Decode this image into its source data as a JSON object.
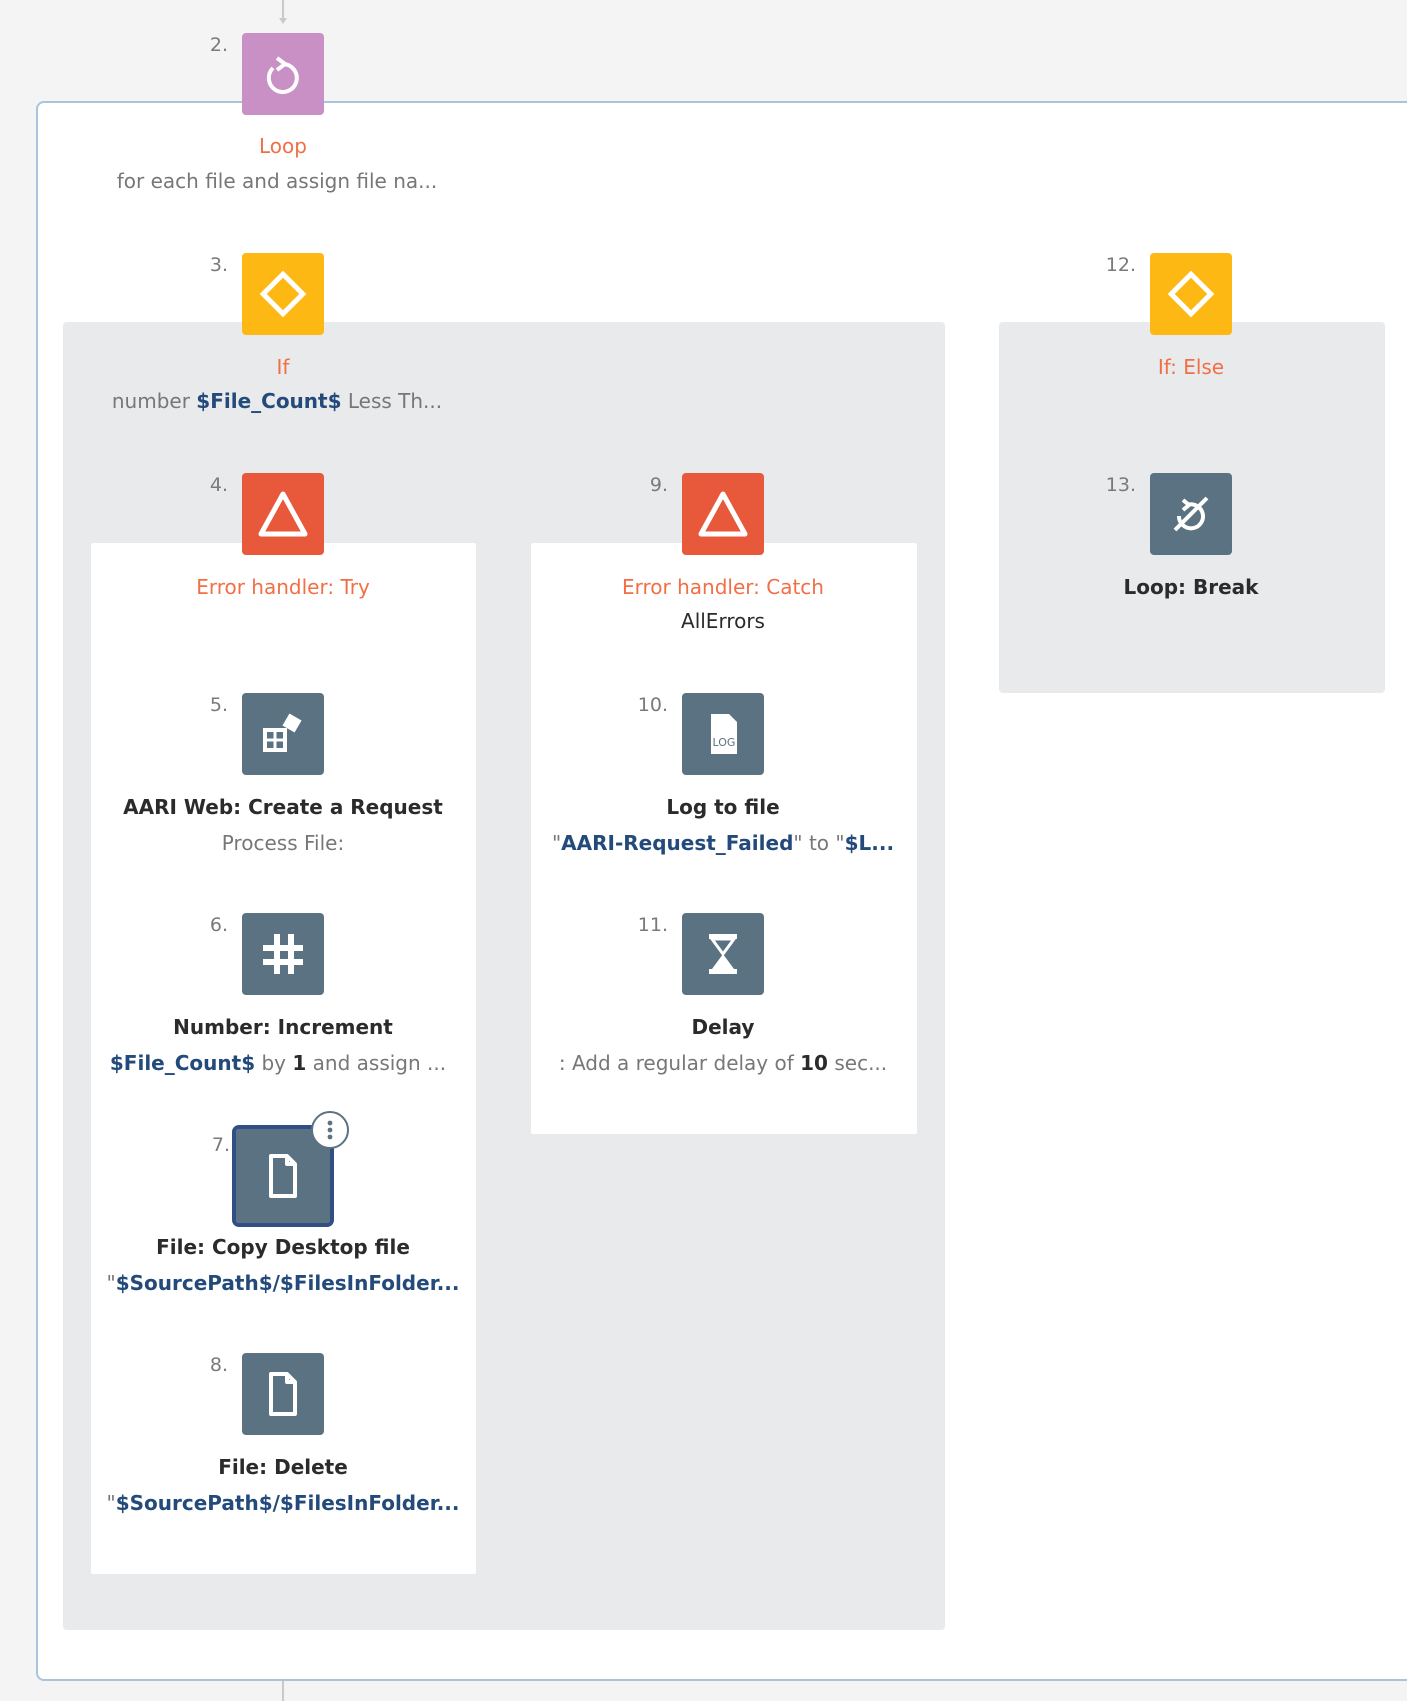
{
  "nodes": {
    "n2": {
      "num": "2.",
      "title": "Loop",
      "sub": "for each file and assign file na..."
    },
    "n3": {
      "num": "3.",
      "title": "If",
      "sub_pre": "number ",
      "sub_var": "$File_Count$",
      "sub_post": " Less Th..."
    },
    "n4": {
      "num": "4.",
      "title": "Error handler: Try"
    },
    "n5": {
      "num": "5.",
      "title": "AARI Web: Create a Request",
      "sub": "Process File:"
    },
    "n6": {
      "num": "6.",
      "title": "Number: Increment",
      "sub_var": "$File_Count$",
      "sub_mid": " by ",
      "sub_num": "1",
      "sub_post": " and assign ..."
    },
    "n7": {
      "num": "7.",
      "title": "File: Copy Desktop file",
      "sub_q": "\"",
      "sub_var": "$SourcePath$/$FilesInFolder..."
    },
    "n8": {
      "num": "8.",
      "title": "File: Delete",
      "sub_q": "\"",
      "sub_var": "$SourcePath$/$FilesInFolder..."
    },
    "n9": {
      "num": "9.",
      "title": "Error handler: Catch",
      "sub": "AllErrors"
    },
    "n10": {
      "num": "10.",
      "title": "Log to file",
      "sub_q": "\"",
      "sub_var": "AARI-Request_Failed",
      "sub_mid": "\" to \"",
      "sub_var2": "$L..."
    },
    "n11": {
      "num": "11.",
      "title": "Delay",
      "sub_pre": ": Add a regular delay of ",
      "sub_num": "10",
      "sub_post": " sec..."
    },
    "n12": {
      "num": "12.",
      "title": "If: Else"
    },
    "n13": {
      "num": "13.",
      "title": "Loop: Break"
    }
  },
  "icons": {
    "n2": "loop-icon",
    "n3": "if-diamond-icon",
    "n4": "error-triangle-icon",
    "n5": "aari-web-icon",
    "n6": "number-hash-icon",
    "n7": "file-icon",
    "n8": "file-icon",
    "n9": "error-triangle-icon",
    "n10": "log-file-icon",
    "n11": "hourglass-icon",
    "n12": "if-diamond-icon",
    "n13": "loop-break-icon"
  },
  "log_icon_text": "LOG",
  "colors": {
    "loop": "#c990c6",
    "if": "#fdb813",
    "error": "#e8593c",
    "action": "#5a7281",
    "title_orange": "#f26f45",
    "variable": "#234a7a",
    "selected_outline": "#2f4f85"
  }
}
